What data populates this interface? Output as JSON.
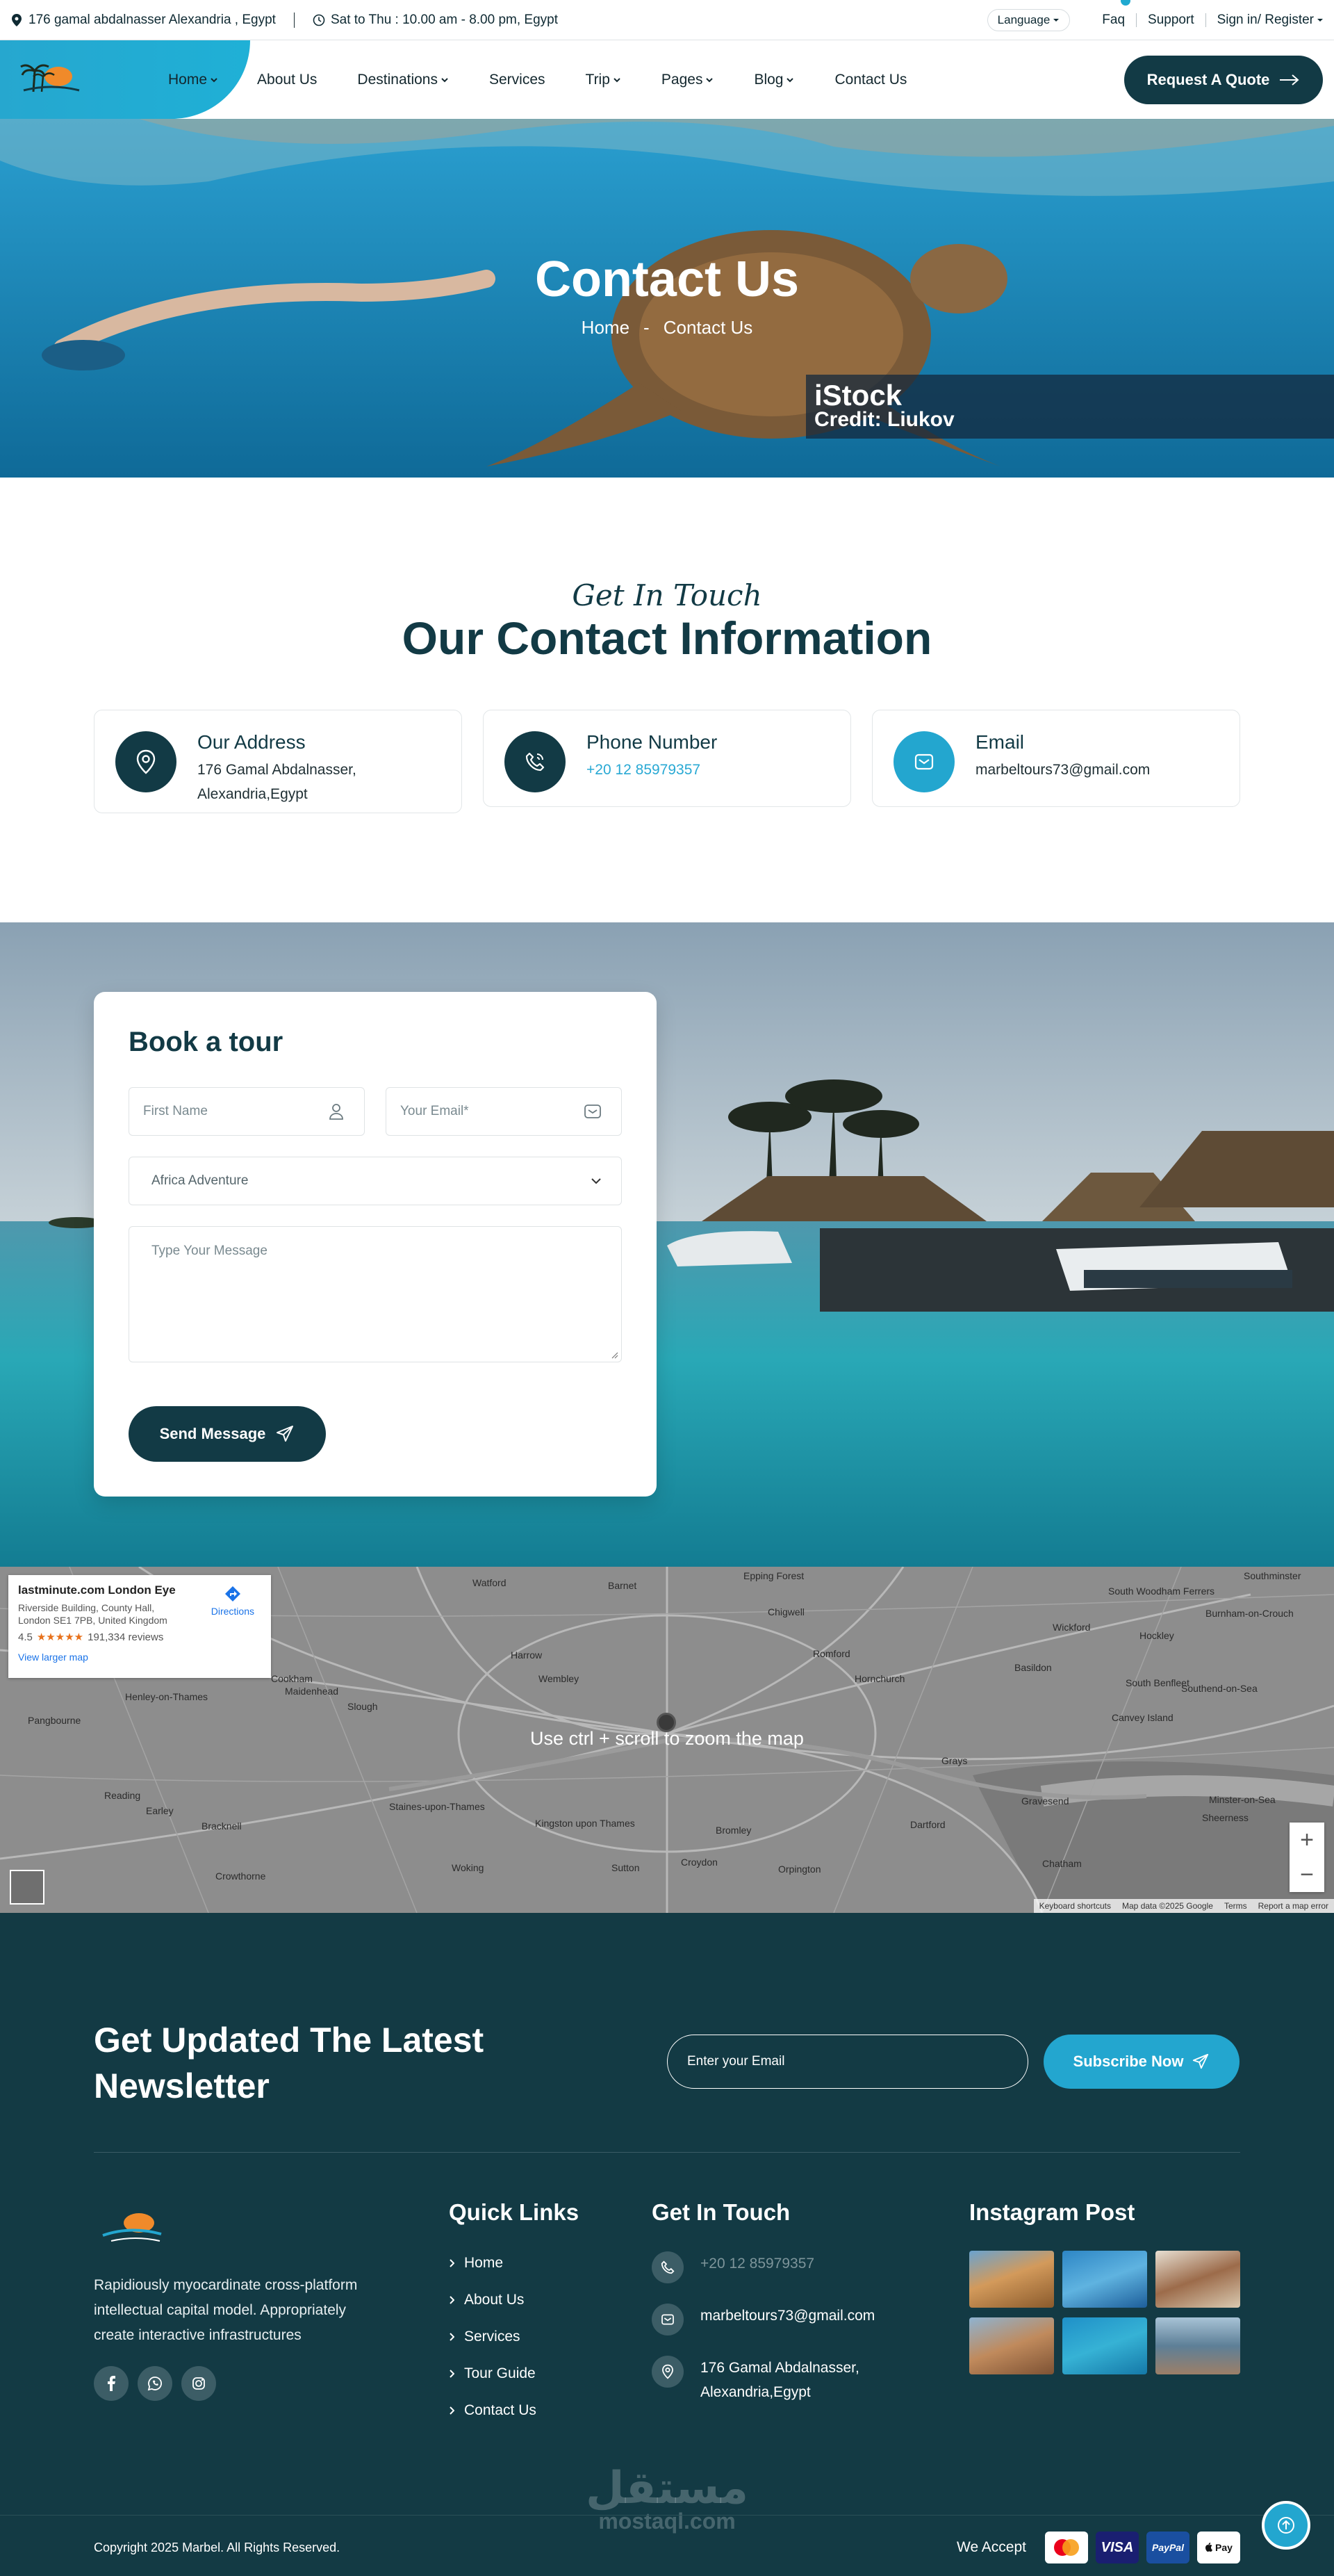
{
  "topbar": {
    "address": "176 gamal abdalnasser Alexandria , Egypt",
    "hours": "Sat to Thu : 10.00 am - 8.00 pm, Egypt",
    "language": "Language",
    "faq": "Faq",
    "support": "Support",
    "signin": "Sign in/ Register"
  },
  "nav": {
    "items": [
      "Home",
      "About Us",
      "Destinations",
      "Services",
      "Trip",
      "Pages",
      "Blog",
      "Contact Us"
    ],
    "quote_button": "Request A Quote"
  },
  "hero": {
    "title": "Contact Us",
    "crumb_home": "Home",
    "crumb_sep": "-",
    "crumb_current": "Contact Us",
    "watermark_brand": "iStock",
    "watermark_credit": "Credit: Liukov"
  },
  "contact": {
    "script": "Get In Touch",
    "title": "Our Contact Information",
    "cards": [
      {
        "title": "Our Address",
        "line1": "176 Gamal Abdalnasser,",
        "line2": "Alexandria,Egypt"
      },
      {
        "title": "Phone Number",
        "line1": "+20 12 85979357"
      },
      {
        "title": "Email",
        "line1": "marbeltours73@gmail.com"
      }
    ]
  },
  "booking": {
    "title": "Book a tour",
    "first_name_placeholder": "First Name",
    "email_placeholder": "Your Email*",
    "tour_selected": "Africa Adventure",
    "message_placeholder": "Type Your Message",
    "send_button": "Send Message"
  },
  "map": {
    "place": "lastminute.com London Eye",
    "address": "Riverside Building, County Hall, London SE1 7PB, United Kingdom",
    "rating": "4.5",
    "stars": "★★★★★",
    "reviews": "191,334 reviews",
    "larger": "View larger map",
    "directions": "Directions",
    "hint": "Use ctrl + scroll to zoom the map",
    "zoom_in": "+",
    "zoom_out": "−",
    "footer": [
      "Keyboard shortcuts",
      "Map data ©2025 Google",
      "Terms",
      "Report a map error"
    ],
    "towns": [
      "Watford",
      "Barnet",
      "Epping Forest",
      "South Woodham Ferrers",
      "Southminster",
      "Chigwell",
      "Wickford",
      "Hockley",
      "Burnham-on-Crouch",
      "Harrow",
      "Wembley",
      "Romford",
      "Basildon",
      "South Benfleet",
      "Southend-on-Sea",
      "Slough",
      "Hornchurch",
      "Canvey Island",
      "Reading",
      "Woking",
      "Kingston upon Thames",
      "Bromley",
      "Gravesend",
      "Sheerness",
      "Chatham",
      "Sutton",
      "Croydon",
      "Orpington",
      "Bracknell",
      "Crowthorne",
      "Maidenhead",
      "Cookham",
      "Henley-on-Thames",
      "Pangbourne",
      "Earley",
      "Staines-upon-Thames",
      "Dartford",
      "Grays",
      "Minster-on-Sea"
    ]
  },
  "footer": {
    "newsletter_title": "Get Updated The Latest Newsletter",
    "email_placeholder": "Enter your Email",
    "subscribe_button": "Subscribe Now",
    "description": "Rapidiously myocardinate cross-platform intellectual capital model. Appropriately create interactive infrastructures",
    "quick_links_title": "Quick Links",
    "quick_links": [
      "Home",
      "About Us",
      "Services",
      "Tour Guide",
      "Contact Us"
    ],
    "get_in_touch_title": "Get In Touch",
    "phone": "+20 12 85979357",
    "email": "marbeltours73@gmail.com",
    "address1": "176 Gamal Abdalnasser,",
    "address2": "Alexandria,Egypt",
    "instagram_title": "Instagram Post",
    "copyright": "Copyright 2025 Marbel. All Rights Reserved.",
    "we_accept": "We Accept",
    "payments": [
      "Mastercard",
      "VISA",
      "PayPal",
      "Pay"
    ],
    "watermark_ar": "مستقل",
    "watermark_la": "mostaql.com"
  },
  "colors": {
    "brand_dark": "#123a45",
    "accent": "#23a6cf",
    "footer_bg": "#133a44"
  }
}
